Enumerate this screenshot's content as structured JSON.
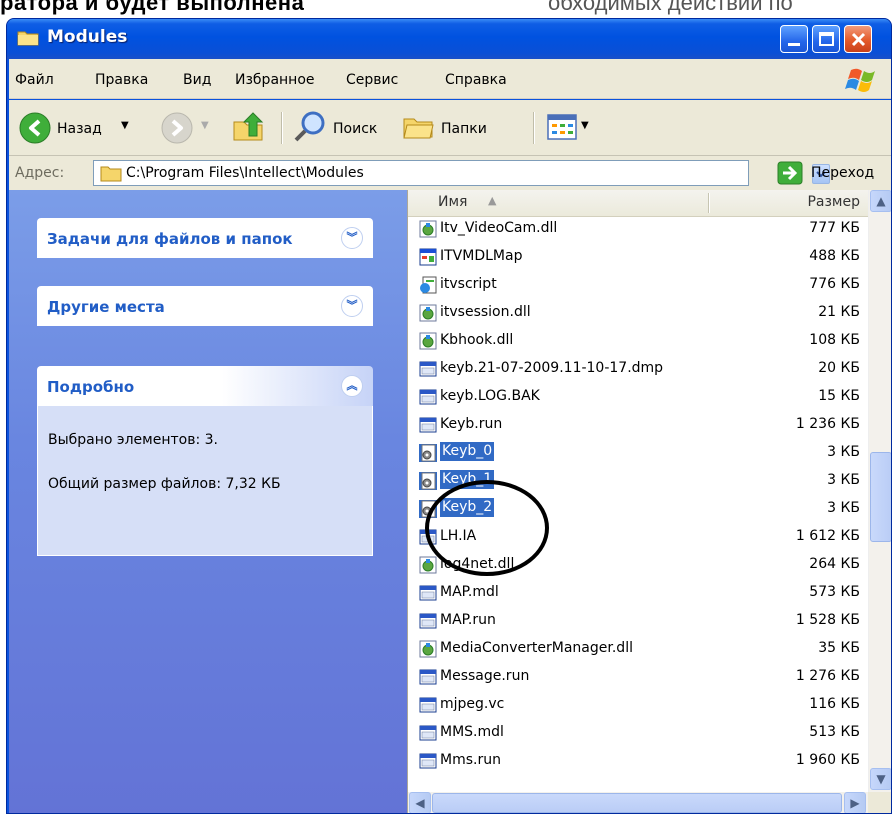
{
  "doc_strip": {
    "bold_text": "ратора и будет выполнена",
    "light_text": "обходимых действий по настройке"
  },
  "window": {
    "title": "Modules",
    "menu": [
      "Файл",
      "Правка",
      "Вид",
      "Избранное",
      "Сервис",
      "Справка"
    ],
    "toolbar": {
      "back": "Назад",
      "search": "Поиск",
      "folders": "Папки"
    },
    "address": {
      "label": "Адрес:",
      "path": "C:\\Program Files\\Intellect\\Modules",
      "go": "Переход"
    }
  },
  "tasks": {
    "file_tasks": "Задачи для файлов и папок",
    "other_places": "Другие места",
    "details": {
      "header": "Подробно",
      "selected": "Выбрано элементов: 3.",
      "total_size": "Общий размер файлов: 7,32 КБ"
    }
  },
  "list": {
    "col_name": "Имя",
    "col_size": "Размер",
    "rows": [
      {
        "name": "Itv_VideoCam.dll",
        "size": "777 КБ",
        "icon": "dll-icon"
      },
      {
        "name": "ITVMDLMap",
        "size": "488 КБ",
        "icon": "exe-icon"
      },
      {
        "name": "itvscript",
        "size": "776 КБ",
        "icon": "script-icon"
      },
      {
        "name": "itvsession.dll",
        "size": "21 КБ",
        "icon": "dll-icon"
      },
      {
        "name": "Kbhook.dll",
        "size": "108 КБ",
        "icon": "dll-icon"
      },
      {
        "name": "keyb.21-07-2009.11-10-17.dmp",
        "size": "20 КБ",
        "icon": "file-icon"
      },
      {
        "name": "keyb.LOG.BAK",
        "size": "15 КБ",
        "icon": "file-icon"
      },
      {
        "name": "Keyb.run",
        "size": "1 236 КБ",
        "icon": "file-icon"
      },
      {
        "name": "Keyb_0",
        "size": "3 КБ",
        "icon": "config-icon",
        "selected": true
      },
      {
        "name": "Keyb_1",
        "size": "3 КБ",
        "icon": "config-icon",
        "selected": true
      },
      {
        "name": "Keyb_2",
        "size": "3 КБ",
        "icon": "config-icon",
        "selected": true
      },
      {
        "name": "LH.IA",
        "size": "1 612 КБ",
        "icon": "file-icon"
      },
      {
        "name": "log4net.dll",
        "size": "264 КБ",
        "icon": "dll-icon"
      },
      {
        "name": "MAP.mdl",
        "size": "573 КБ",
        "icon": "file-icon"
      },
      {
        "name": "MAP.run",
        "size": "1 528 КБ",
        "icon": "file-icon"
      },
      {
        "name": "MediaConverterManager.dll",
        "size": "35 КБ",
        "icon": "dll-icon"
      },
      {
        "name": "Message.run",
        "size": "1 276 КБ",
        "icon": "file-icon"
      },
      {
        "name": "mjpeg.vc",
        "size": "116 КБ",
        "icon": "file-icon"
      },
      {
        "name": "MMS.mdl",
        "size": "513 КБ",
        "icon": "file-icon"
      },
      {
        "name": "Mms.run",
        "size": "1 960 КБ",
        "icon": "file-icon"
      }
    ]
  }
}
